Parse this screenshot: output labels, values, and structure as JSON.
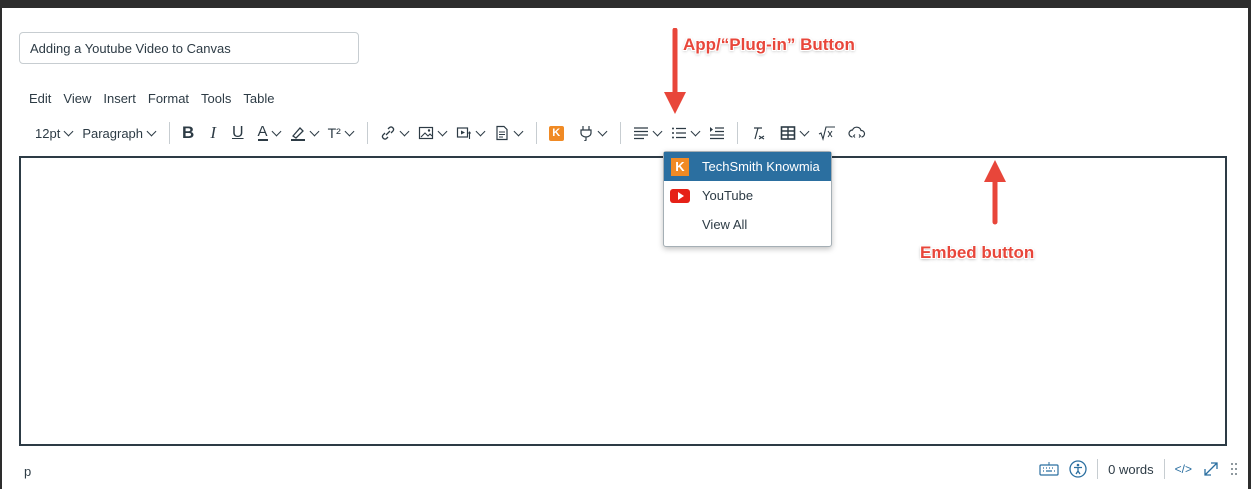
{
  "title_input": {
    "value": "Adding a Youtube Video to Canvas"
  },
  "menubar": [
    "Edit",
    "View",
    "Insert",
    "Format",
    "Tools",
    "Table"
  ],
  "toolbar": {
    "font_size": "12pt",
    "block_format": "Paragraph",
    "bold": "B",
    "italic": "I",
    "underline": "U",
    "text_color": "A",
    "superscript": "T²",
    "knowmia_icon": "K"
  },
  "apps_menu": {
    "items": [
      {
        "label": "TechSmith Knowmia",
        "icon": "K",
        "active": true
      },
      {
        "label": "YouTube",
        "icon": "youtube-icon"
      },
      {
        "label": "View All"
      }
    ]
  },
  "annotations": {
    "app_button": "App/“Plug-in” Button",
    "embed_button": "Embed button"
  },
  "statusbar": {
    "path": "p",
    "word_count": "0 words",
    "html_toggle": "</>"
  },
  "colors": {
    "accent": "#2b6fa0",
    "annotation": "#e8463a",
    "knowmia": "#f08a24",
    "youtube": "#e62117"
  }
}
